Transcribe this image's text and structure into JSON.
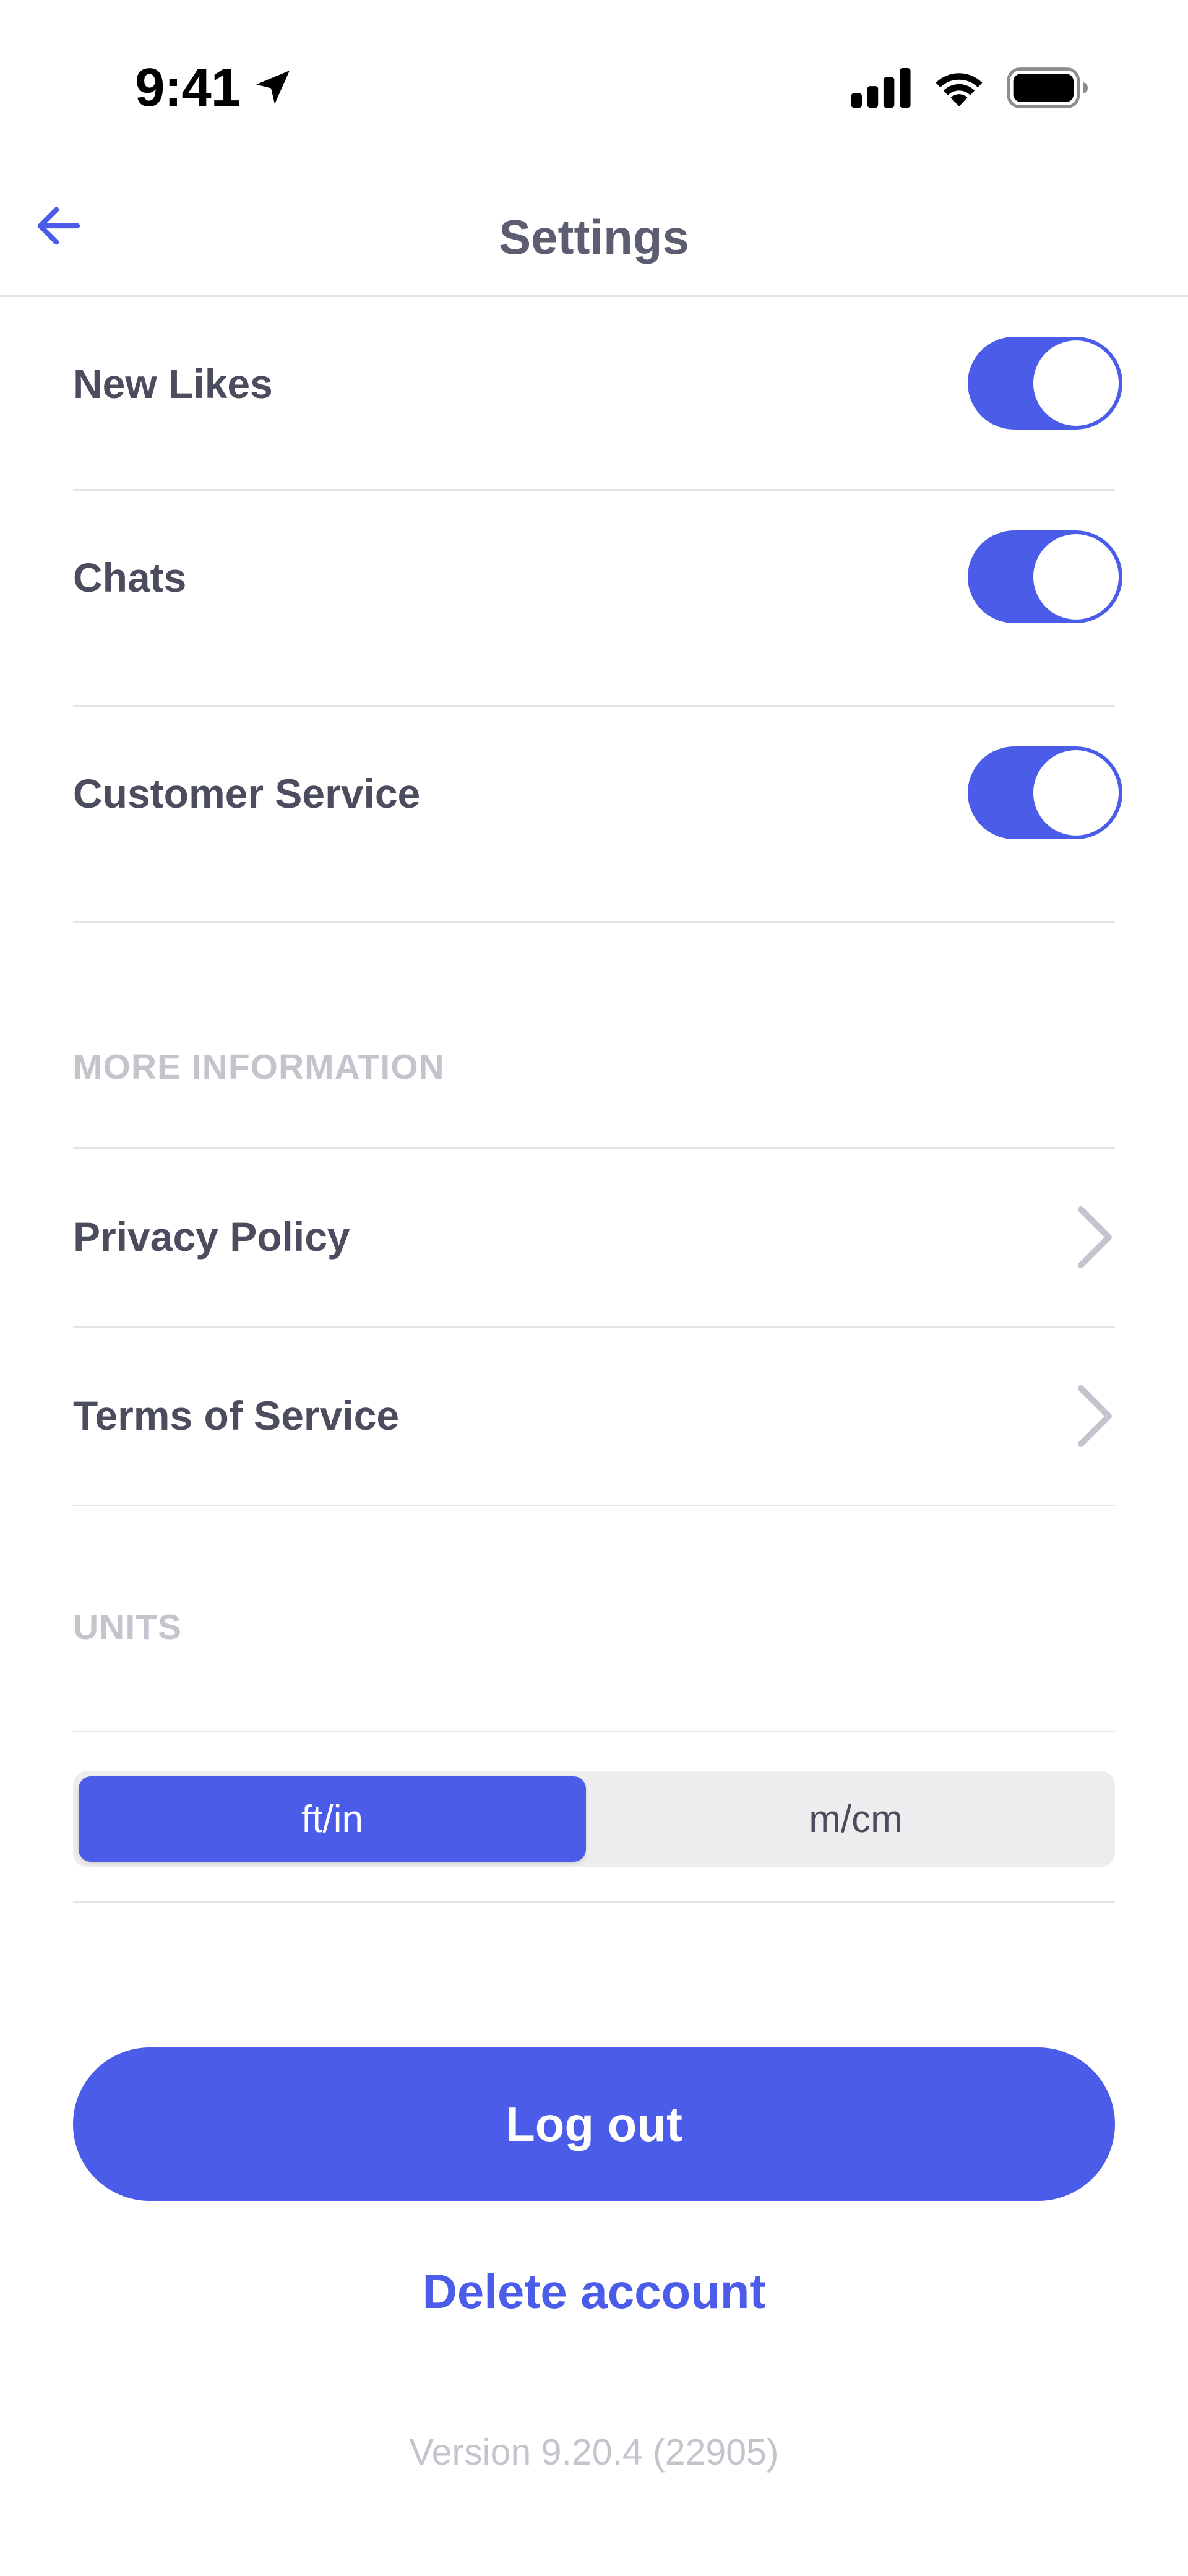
{
  "status_bar": {
    "time": "9:41",
    "icons": [
      "location-arrow-icon",
      "cellular-signal-icon",
      "wifi-icon",
      "battery-icon"
    ]
  },
  "nav": {
    "back_icon": "arrow-left-icon",
    "title": "Settings"
  },
  "notifications": [
    {
      "label": "New Likes",
      "enabled": true
    },
    {
      "label": "Chats",
      "enabled": true
    },
    {
      "label": "Customer Service",
      "enabled": true
    }
  ],
  "more_information": {
    "header": "MORE INFORMATION",
    "items": [
      {
        "label": "Privacy Policy",
        "icon": "chevron-right-icon"
      },
      {
        "label": "Terms of Service",
        "icon": "chevron-right-icon"
      }
    ]
  },
  "units": {
    "header": "UNITS",
    "options": [
      "ft/in",
      "m/cm"
    ],
    "selected": "ft/in"
  },
  "actions": {
    "logout_label": "Log out",
    "delete_label": "Delete account"
  },
  "version": "Version 9.20.4 (22905)",
  "colors": {
    "accent": "#4a5ce8",
    "label": "#4b4c5e",
    "title": "#5c5d70",
    "muted": "#c4c5cc",
    "divider": "#e3e3e8",
    "segment_bg": "#ededf0"
  }
}
